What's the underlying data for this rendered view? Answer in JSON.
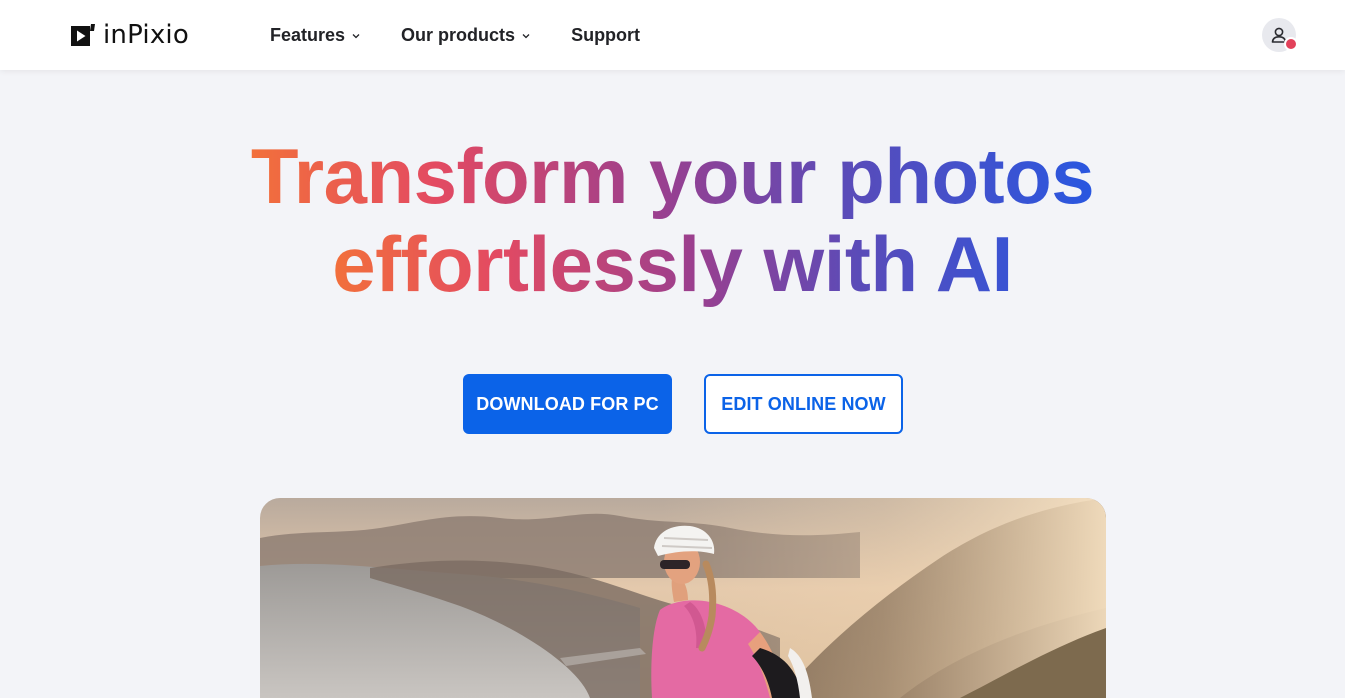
{
  "header": {
    "logo_text": "inPixio",
    "logo_icon": "play-logo-icon",
    "nav": [
      {
        "label": "Features",
        "has_dropdown": true
      },
      {
        "label": "Our products",
        "has_dropdown": true
      },
      {
        "label": "Support",
        "has_dropdown": false
      }
    ],
    "account_icon": "user-icon",
    "account_badge_color": "#e2415a"
  },
  "hero": {
    "title_line1": "Transform your photos",
    "title_line2": "effortlessly with AI",
    "gradient_colors": [
      "#f2703b",
      "#e34a62",
      "#9b3f8e",
      "#5b4bb8",
      "#2957e0"
    ],
    "primary_cta": "DOWNLOAD FOR PC",
    "secondary_cta": "EDIT ONLINE NOW",
    "image_subject": "cyclist-coastline-photo"
  },
  "colors": {
    "accent": "#0b63e8",
    "background": "#f3f4f8"
  }
}
